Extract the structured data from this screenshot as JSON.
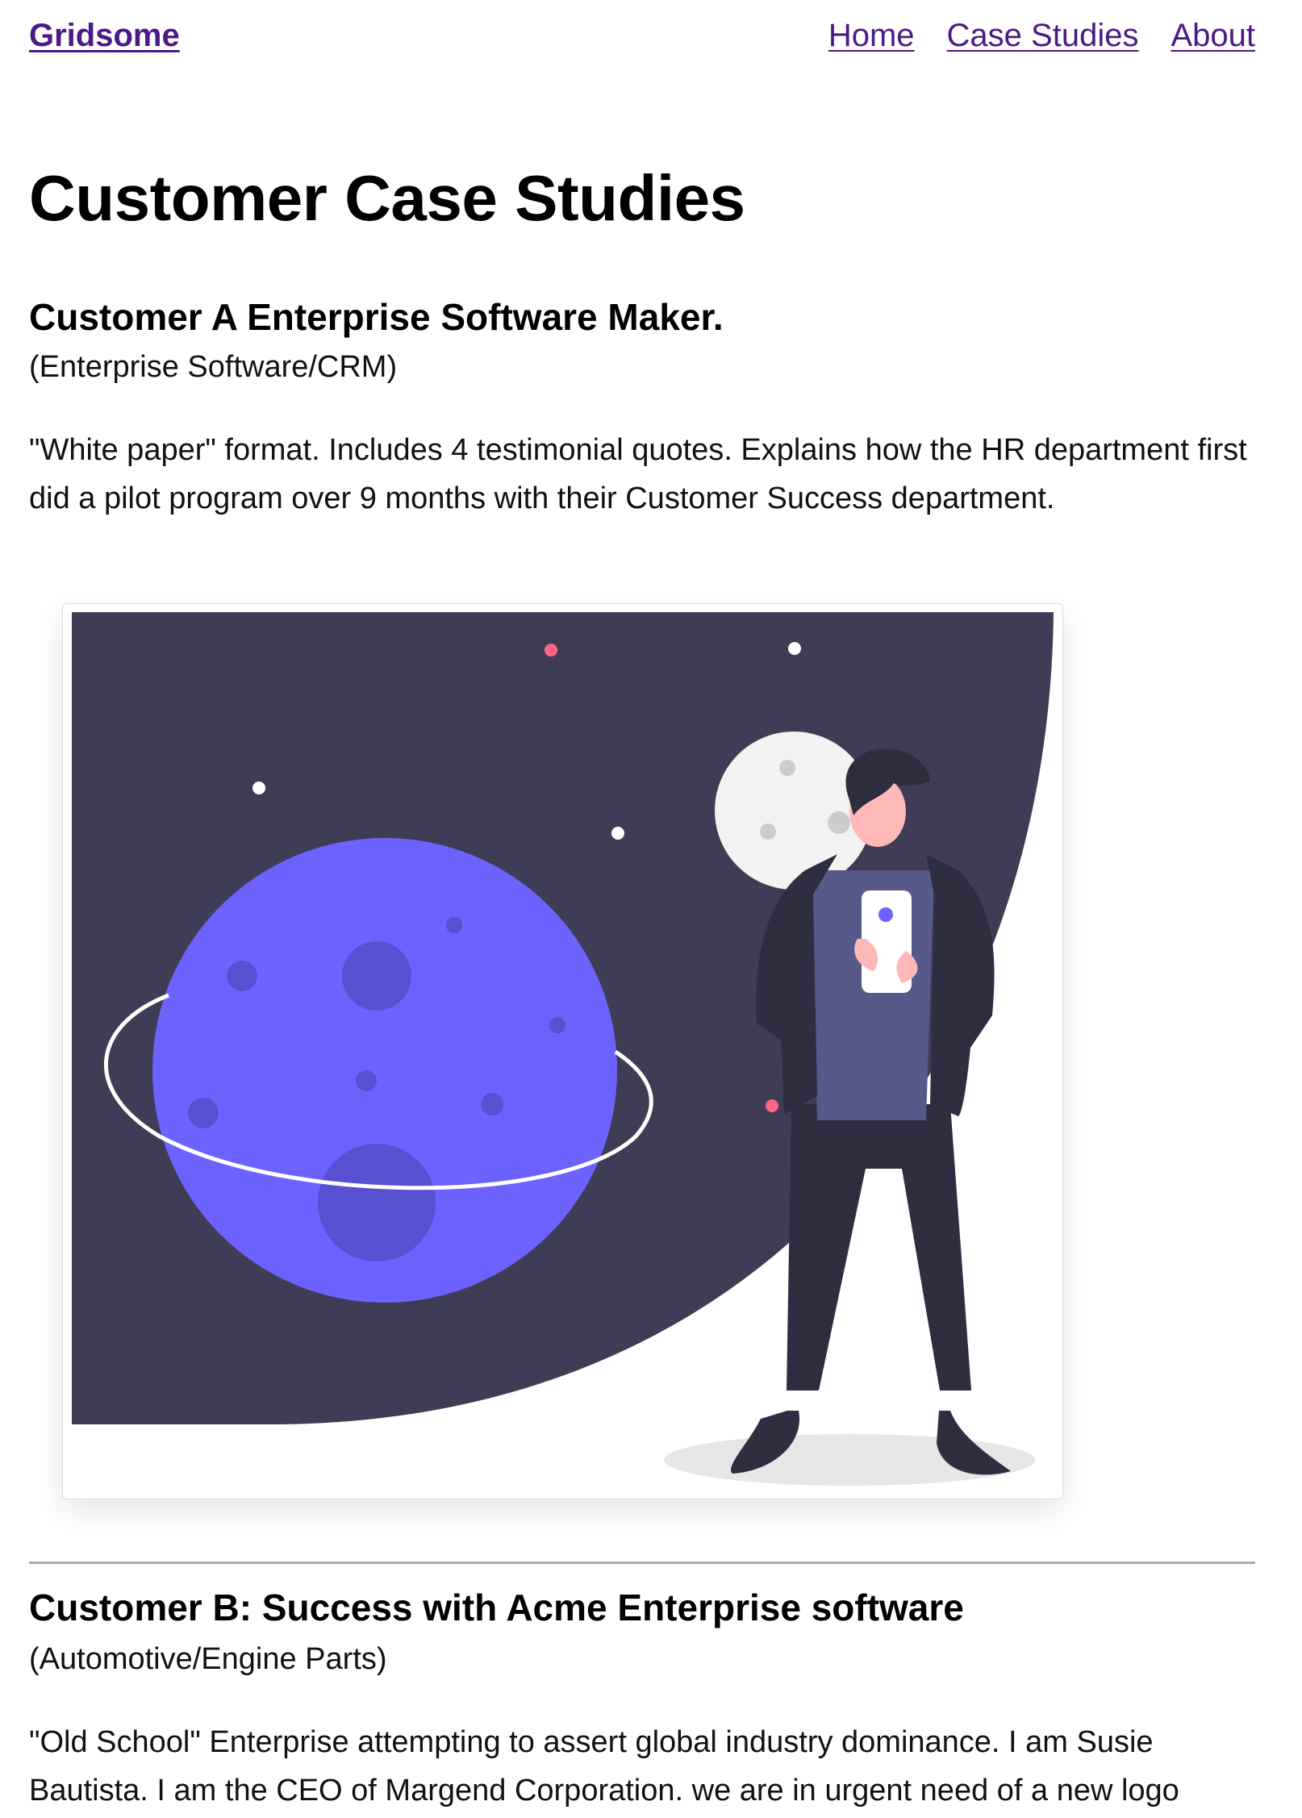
{
  "header": {
    "brand": "Gridsome",
    "nav": [
      "Home",
      "Case Studies",
      "About"
    ]
  },
  "main": {
    "title": "Customer Case Studies",
    "cases": [
      {
        "title": "Customer A Enterprise Software Maker.",
        "industry": "(Enterprise Software/CRM)",
        "description": "\"White paper\" format. Includes 4 testimonial quotes. Explains how the HR department first did a pilot program over 9 months with their Customer Success department."
      },
      {
        "title": "Customer B: Success with Acme Enterprise software",
        "industry": "(Automotive/Engine Parts)",
        "description": "\"Old School\" Enterprise attempting to assert global industry dominance. I am Susie Bautista. I am the CEO of Margend Corporation. we are in urgent need of a new logo"
      }
    ]
  },
  "colors": {
    "link": "#4c1a86",
    "space": "#3f3d56",
    "planet": "#6c63ff",
    "accent_red": "#ff6584"
  },
  "illustration": {
    "icon": "astronaut-planet-illustration"
  }
}
